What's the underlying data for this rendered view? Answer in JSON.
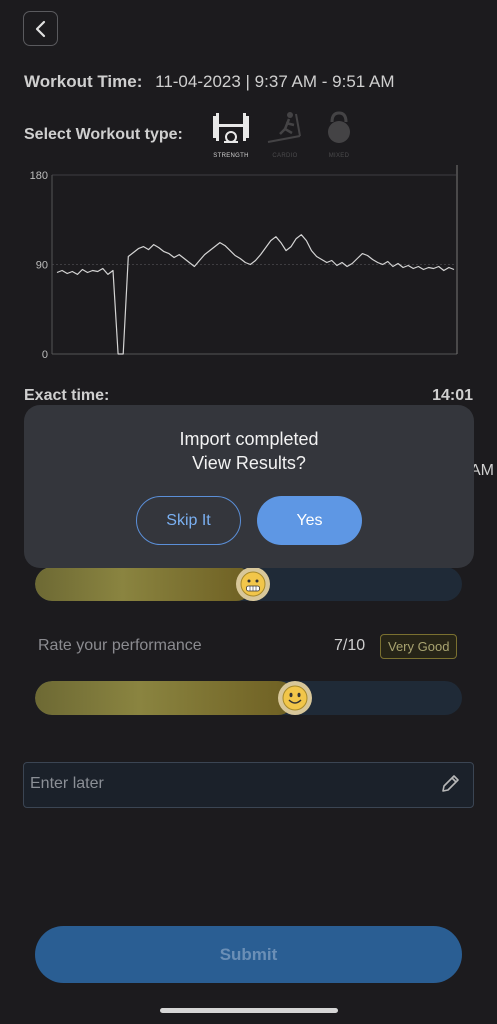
{
  "header": {
    "workout_time_label": "Workout Time:",
    "workout_time_value": "11-04-2023 | 9:37 AM - 9:51 AM",
    "select_type_label": "Select Workout type:",
    "types": [
      {
        "label": "STRENGTH",
        "icon": "barbell-icon",
        "selected": true
      },
      {
        "label": "CARDIO",
        "icon": "treadmill-icon",
        "selected": false
      },
      {
        "label": "MIXED",
        "icon": "kettlebell-icon",
        "selected": false
      }
    ]
  },
  "chart_data": {
    "type": "line",
    "ytick_labels": [
      "180",
      "90",
      "0"
    ],
    "ylim": [
      0,
      180
    ],
    "grid": true,
    "series": [
      {
        "values": [
          82,
          84,
          81,
          83,
          80,
          85,
          82,
          84,
          83,
          86,
          80,
          84,
          0,
          0,
          98,
          102,
          106,
          108,
          105,
          110,
          107,
          103,
          101,
          97,
          100,
          96,
          92,
          88,
          94,
          100,
          104,
          108,
          112,
          109,
          104,
          99,
          96,
          92,
          90,
          94,
          100,
          107,
          114,
          118,
          112,
          104,
          108,
          116,
          120,
          114,
          104,
          98,
          95,
          92,
          94,
          89,
          92,
          88,
          91,
          96,
          101,
          99,
          95,
          92,
          90,
          93,
          88,
          91,
          87,
          89,
          86,
          88,
          85,
          87,
          86,
          88,
          84,
          87,
          85
        ]
      }
    ]
  },
  "exact_time_label": "Exact time:",
  "exact_time_value": "14:01",
  "partial_text": "AM",
  "dialog": {
    "line1": "Import completed",
    "line2": "View Results?",
    "skip_label": "Skip It",
    "yes_label": "Yes"
  },
  "slider1": {
    "value_fraction": 0.51,
    "icon": "grimace-face-icon"
  },
  "performance": {
    "label": "Rate your performance",
    "value": "7/10",
    "badge": "Very Good",
    "value_fraction": 0.61,
    "icon": "smile-face-icon"
  },
  "note": {
    "placeholder": "Enter later",
    "icon": "pencil-icon"
  },
  "submit_label": "Submit",
  "colors": {
    "background": "#1c1b1e",
    "accent": "#5e97e4",
    "submit": "#2a5e93",
    "dialog": "#34363c"
  }
}
